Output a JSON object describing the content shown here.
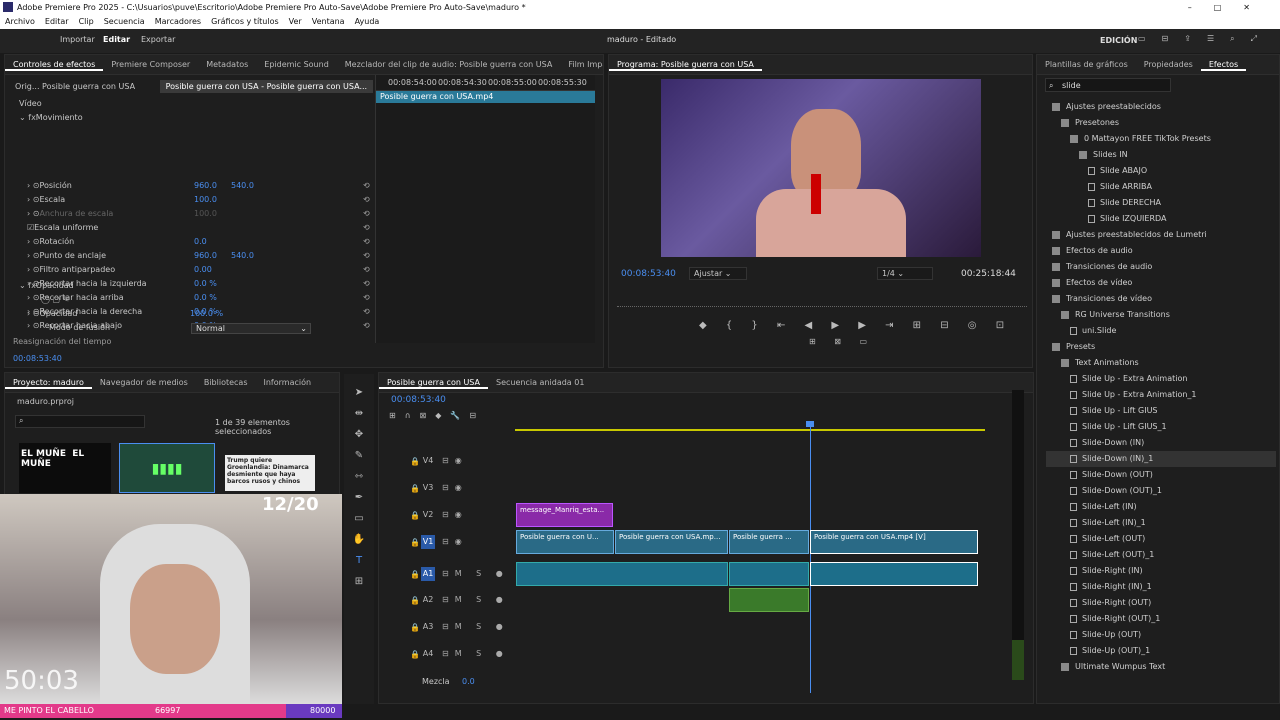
{
  "window": {
    "title": "Adobe Premiere Pro 2025 - C:\\Usuarios\\puve\\Escritorio\\Adobe Premiere Pro Auto-Save\\Adobe Premiere Pro Auto-Save\\maduro *"
  },
  "menu": [
    "Archivo",
    "Editar",
    "Clip",
    "Secuencia",
    "Marcadores",
    "Gráficos y títulos",
    "Ver",
    "Ventana",
    "Ayuda"
  ],
  "header": {
    "workspace_tabs": [
      "Importar",
      "Editar",
      "Exportar"
    ],
    "project_status": "maduro - Editado",
    "edition_label": "EDICIÓN"
  },
  "effect_controls": {
    "tabs": [
      "Controles de efectos",
      "Premiere Composer",
      "Metadatos",
      "Epidemic Sound",
      "Mezclador del clip de audio: Posible guerra con USA",
      "Film Impac"
    ],
    "source_tabs": [
      "Orig... Posible guerra con USA",
      "Posible guerra con USA - Posible guerra con USA..."
    ],
    "section_video": "Vídeo",
    "section_motion": "Movimiento",
    "props": [
      {
        "name": "Posición",
        "v1": "960.0",
        "v2": "540.0"
      },
      {
        "name": "Escala",
        "v1": "100.0",
        "v2": ""
      },
      {
        "name": "Anchura de escala",
        "v1": "100.0",
        "v2": ""
      },
      {
        "name": "Escala uniforme",
        "v1": "",
        "v2": ""
      },
      {
        "name": "Rotación",
        "v1": "0.0",
        "v2": ""
      },
      {
        "name": "Punto de anclaje",
        "v1": "960.0",
        "v2": "540.0"
      },
      {
        "name": "Filtro antiparpadeo",
        "v1": "0.00",
        "v2": ""
      },
      {
        "name": "Recortar hacia la izquierda",
        "v1": "0.0 %",
        "v2": ""
      },
      {
        "name": "Recortar hacia arriba",
        "v1": "0.0 %",
        "v2": ""
      },
      {
        "name": "Recortar hacia la derecha",
        "v1": "0.0 %",
        "v2": ""
      },
      {
        "name": "Recortar hacia abajo",
        "v1": "0.0 %",
        "v2": ""
      }
    ],
    "section_opacity": "Opacidad",
    "opacity_label": "Opacidad",
    "opacity_value": "100.0 %",
    "blend_label": "Modo de fusión",
    "blend_value": "Normal",
    "remap_label": "Reasignación del tiempo",
    "ruler": [
      "00:08:54:00",
      "00:08:54:30",
      "00:08:55:00",
      "00:08:55:30"
    ],
    "clip_label": "Posible guerra con USA.mp4",
    "timecode": "00:08:53:40"
  },
  "program": {
    "title": "Programa: Posible guerra con USA",
    "timecode": "00:08:53:40",
    "fit": "Ajustar",
    "quality": "1/4",
    "duration": "00:25:18:44"
  },
  "project": {
    "tabs": [
      "Proyecto: maduro",
      "Navegador de medios",
      "Bibliotecas",
      "Información"
    ],
    "file": "maduro.prproj",
    "selection": "1 de 39 elementos seleccionados",
    "thumbs": [
      "EL MUÑE",
      "EL MUÑE",
      "",
      "Trump quiere Groenlandia: Dinamarca desmiente que haya barcos rusos y chinos"
    ]
  },
  "timeline": {
    "tabs": [
      "Posible guerra con USA",
      "Secuencia anidada 01"
    ],
    "timecode": "00:08:53:40",
    "tracks": [
      "V4",
      "V3",
      "V2",
      "V1",
      "A1",
      "A2",
      "A3",
      "A4"
    ],
    "mix_label": "Mezcla",
    "mix_value": "0.0",
    "clips": {
      "v2": "message_Manriq_esta...",
      "v1a": "Posible guerra con U...",
      "v1b": "Posible guerra con USA.mp...",
      "v1c": "Posible guerra ...",
      "v1d": "Posible guerra con USA.mp4 [V]"
    }
  },
  "effects": {
    "tabs": [
      "Plantillas de gráficos",
      "Propiedades",
      "Efectos"
    ],
    "search": "slide",
    "tree": [
      {
        "t": "Ajustes preestablecidos",
        "l": 0,
        "k": "f"
      },
      {
        "t": "Presetones",
        "l": 1,
        "k": "f"
      },
      {
        "t": "0 Mattayon FREE TikTok Presets",
        "l": 2,
        "k": "f"
      },
      {
        "t": "Slides IN",
        "l": 3,
        "k": "f"
      },
      {
        "t": "Slide ABAJO",
        "l": 4,
        "k": "x"
      },
      {
        "t": "Slide ARRIBA",
        "l": 4,
        "k": "x"
      },
      {
        "t": "Slide DERECHA",
        "l": 4,
        "k": "x"
      },
      {
        "t": "Slide IZQUIERDA",
        "l": 4,
        "k": "x"
      },
      {
        "t": "Ajustes preestablecidos de Lumetri",
        "l": 0,
        "k": "f"
      },
      {
        "t": "Efectos de audio",
        "l": 0,
        "k": "f"
      },
      {
        "t": "Transiciones de audio",
        "l": 0,
        "k": "f"
      },
      {
        "t": "Efectos de vídeo",
        "l": 0,
        "k": "f"
      },
      {
        "t": "Transiciones de vídeo",
        "l": 0,
        "k": "f"
      },
      {
        "t": "RG Universe Transitions",
        "l": 1,
        "k": "f"
      },
      {
        "t": "uni.Slide",
        "l": 2,
        "k": "x"
      },
      {
        "t": "Presets",
        "l": 0,
        "k": "f"
      },
      {
        "t": "Text Animations",
        "l": 1,
        "k": "f"
      },
      {
        "t": "Slide Up - Extra Animation",
        "l": 2,
        "k": "x"
      },
      {
        "t": "Slide Up - Extra Animation_1",
        "l": 2,
        "k": "x"
      },
      {
        "t": "Slide Up - Lift GIUS",
        "l": 2,
        "k": "x"
      },
      {
        "t": "Slide Up - Lift GIUS_1",
        "l": 2,
        "k": "x"
      },
      {
        "t": "Slide-Down (IN)",
        "l": 2,
        "k": "x"
      },
      {
        "t": "Slide-Down (IN)_1",
        "l": 2,
        "k": "x"
      },
      {
        "t": "Slide-Down (OUT)",
        "l": 2,
        "k": "x"
      },
      {
        "t": "Slide-Down (OUT)_1",
        "l": 2,
        "k": "x"
      },
      {
        "t": "Slide-Left (IN)",
        "l": 2,
        "k": "x"
      },
      {
        "t": "Slide-Left (IN)_1",
        "l": 2,
        "k": "x"
      },
      {
        "t": "Slide-Left (OUT)",
        "l": 2,
        "k": "x"
      },
      {
        "t": "Slide-Left (OUT)_1",
        "l": 2,
        "k": "x"
      },
      {
        "t": "Slide-Right (IN)",
        "l": 2,
        "k": "x"
      },
      {
        "t": "Slide-Right (IN)_1",
        "l": 2,
        "k": "x"
      },
      {
        "t": "Slide-Right (OUT)",
        "l": 2,
        "k": "x"
      },
      {
        "t": "Slide-Right (OUT)_1",
        "l": 2,
        "k": "x"
      },
      {
        "t": "Slide-Up (OUT)",
        "l": 2,
        "k": "x"
      },
      {
        "t": "Slide-Up (OUT)_1",
        "l": 2,
        "k": "x"
      },
      {
        "t": "Ultimate Wumpus Text",
        "l": 1,
        "k": "f"
      }
    ]
  },
  "overlay": {
    "counter": "12/20",
    "timer": "50:03",
    "bar_text": "ME PINTO EL CABELLO",
    "bar_count": "66997",
    "bar_goal": "80000"
  }
}
